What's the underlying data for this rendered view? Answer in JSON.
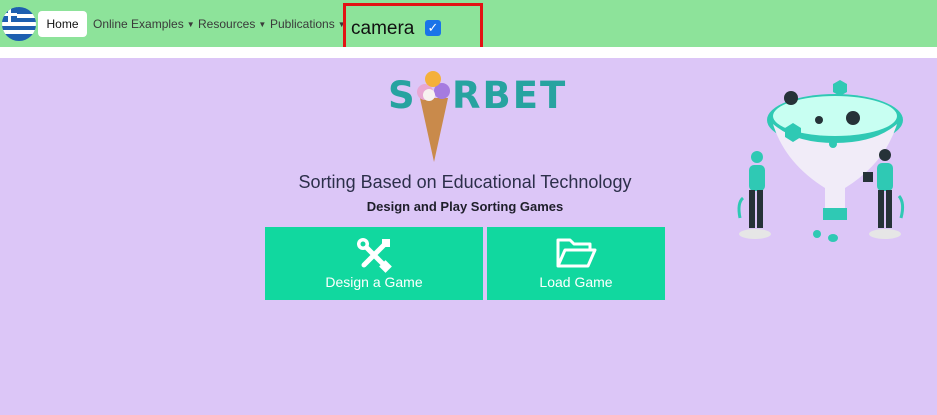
{
  "navbar": {
    "flag_icon": "greek-flag-icon",
    "home_label": "Home",
    "menus": [
      {
        "label": "Online Examples"
      },
      {
        "label": "Resources"
      },
      {
        "label": "Publications"
      }
    ],
    "camera_label": "camera",
    "camera_checked": true
  },
  "hero": {
    "logo_text_left": "S",
    "logo_text_right": "RBET",
    "tagline": "Sorting Based on Educational Technology",
    "subtitle": "Design and Play Sorting Games"
  },
  "actions": {
    "design_label": "Design a Game",
    "design_icon": "tools-icon",
    "load_label": "Load Game",
    "load_icon": "folder-open-icon"
  },
  "colors": {
    "navbar": "#8de39a",
    "background": "#dcc6f7",
    "button": "#11d89f",
    "logo_teal": "#27a3a0",
    "highlight_border": "#e31313"
  }
}
